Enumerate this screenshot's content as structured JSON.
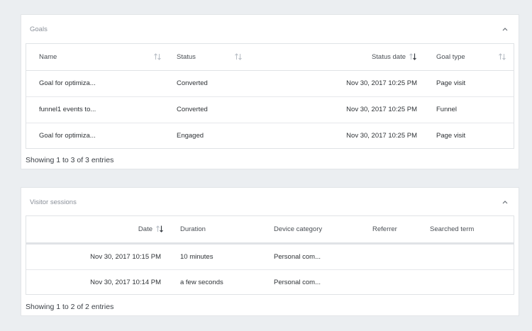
{
  "goals": {
    "title": "Goals",
    "columns": {
      "name": "Name",
      "status": "Status",
      "status_date": "Status date",
      "goal_type": "Goal type"
    },
    "rows": [
      {
        "name": "Goal for optimiza...",
        "status": "Converted",
        "status_date": "Nov 30, 2017 10:25 PM",
        "goal_type": "Page visit"
      },
      {
        "name": "funnel1 events to...",
        "status": "Converted",
        "status_date": "Nov 30, 2017 10:25 PM",
        "goal_type": "Funnel"
      },
      {
        "name": "Goal for optimiza...",
        "status": "Engaged",
        "status_date": "Nov 30, 2017 10:25 PM",
        "goal_type": "Page visit"
      }
    ],
    "footer": "Showing 1 to 3 of 3 entries"
  },
  "sessions": {
    "title": "Visitor sessions",
    "columns": {
      "date": "Date",
      "duration": "Duration",
      "device_category": "Device category",
      "referrer": "Referrer",
      "searched_term": "Searched term"
    },
    "rows": [
      {
        "date": "Nov 30, 2017 10:15 PM",
        "duration": "10 minutes",
        "device_category": "Personal com...",
        "referrer": "",
        "searched_term": ""
      },
      {
        "date": "Nov 30, 2017 10:14 PM",
        "duration": "a few seconds",
        "device_category": "Personal com...",
        "referrer": "",
        "searched_term": ""
      }
    ],
    "footer": "Showing 1 to 2 of 2 entries"
  },
  "icons": {
    "collapse": "chevron-up-icon",
    "sort": "sort-icon",
    "sort_desc": "sort-descending-icon"
  },
  "colors": {
    "background": "#ebeef1",
    "panel": "#ffffff",
    "border": "#e0e3e6",
    "sort_inactive": "#b8bec5",
    "sort_active": "#3a3f45"
  }
}
